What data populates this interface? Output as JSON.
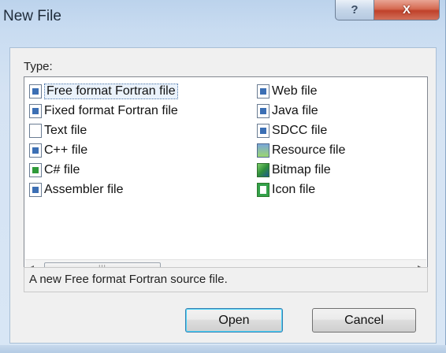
{
  "window": {
    "title": "New File",
    "help_glyph": "?",
    "close_glyph": "X"
  },
  "types_label": "Type:",
  "file_types_left": [
    {
      "label": "Free format Fortran file",
      "icon": "fortran-free-icon"
    },
    {
      "label": "Fixed format Fortran file",
      "icon": "fortran-fixed-icon"
    },
    {
      "label": "Text file",
      "icon": "text-file-icon"
    },
    {
      "label": "C++ file",
      "icon": "cpp-file-icon"
    },
    {
      "label": "C# file",
      "icon": "csharp-file-icon"
    },
    {
      "label": "Assembler file",
      "icon": "assembler-file-icon"
    }
  ],
  "file_types_right": [
    {
      "label": "Web file",
      "icon": "web-file-icon"
    },
    {
      "label": "Java file",
      "icon": "java-file-icon"
    },
    {
      "label": "SDCC file",
      "icon": "sdcc-file-icon"
    },
    {
      "label": "Resource file",
      "icon": "resource-file-icon"
    },
    {
      "label": "Bitmap file",
      "icon": "bitmap-file-icon"
    },
    {
      "label": "Icon file",
      "icon": "icon-file-icon"
    }
  ],
  "selected_type": "Free format Fortran file",
  "scrollbar": {
    "left_arrow": "◂",
    "right_arrow": "▸",
    "thumb_grip": "III"
  },
  "description": "A new Free format Fortran source file.",
  "buttons": {
    "open": "Open",
    "cancel": "Cancel"
  },
  "colors": {
    "close_button": "#c0412a",
    "default_button_focus": "#3c7fb1"
  }
}
